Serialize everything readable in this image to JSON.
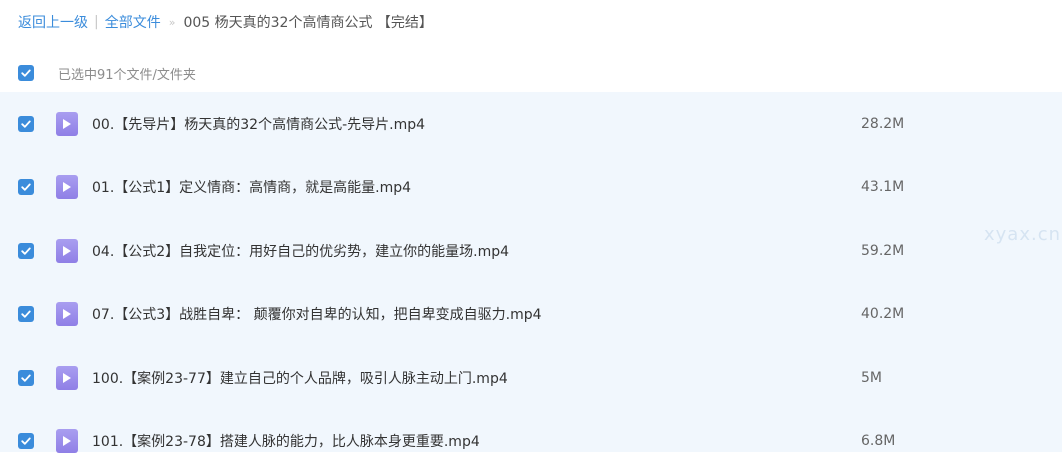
{
  "breadcrumb": {
    "back": "返回上一级",
    "separator": "|",
    "all_files": "全部文件",
    "arrow": "»",
    "current": "005 杨天真的32个高情商公式 【完结】"
  },
  "selection": {
    "checked": true,
    "label": "已选中91个文件/文件夹"
  },
  "files": [
    {
      "name": "00.【先导片】杨天真的32个高情商公式-先导片.mp4",
      "size": "28.2M",
      "checked": true,
      "icon": "video-file-icon"
    },
    {
      "name": "01.【公式1】定义情商：高情商，就是高能量.mp4",
      "size": "43.1M",
      "checked": true,
      "icon": "video-file-icon"
    },
    {
      "name": "04.【公式2】自我定位：用好自己的优劣势，建立你的能量场.mp4",
      "size": "59.2M",
      "checked": true,
      "icon": "video-file-icon"
    },
    {
      "name": "07.【公式3】战胜自卑： 颠覆你对自卑的认知，把自卑变成自驱力.mp4",
      "size": "40.2M",
      "checked": true,
      "icon": "video-file-icon"
    },
    {
      "name": "100.【案例23-77】建立自己的个人品牌，吸引人脉主动上门.mp4",
      "size": "5M",
      "checked": true,
      "icon": "video-file-icon"
    },
    {
      "name": "101.【案例23-78】搭建人脉的能力，比人脉本身更重要.mp4",
      "size": "6.8M",
      "checked": true,
      "icon": "video-file-icon"
    }
  ],
  "watermark": "xyax.cn",
  "colors": {
    "accent": "#3b8cdb",
    "file_icon": "#9a8cee",
    "list_background": "#f1f7fd"
  }
}
